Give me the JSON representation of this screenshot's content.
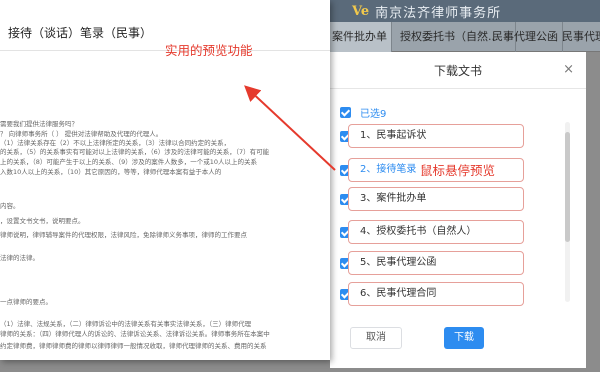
{
  "app": {
    "logo": "Ve",
    "title": "南京法齐律师事务所",
    "tabs": [
      {
        "label": "案件批办单",
        "closable": false
      },
      {
        "label": "授权委托书（自然...",
        "closable": true
      },
      {
        "label": "民事代理公函",
        "closable": false
      },
      {
        "label": "民事代理",
        "closable": false
      }
    ]
  },
  "dialog": {
    "title": "下载文书",
    "close_glyph": "×",
    "select_all_label": "已选9",
    "items": [
      {
        "label": "1、民事起诉状",
        "checked": true
      },
      {
        "label": "2、接待笔录",
        "checked": true
      },
      {
        "label": "3、案件批办单",
        "checked": true
      },
      {
        "label": "4、授权委托书（自然人）",
        "checked": true
      },
      {
        "label": "5、民事代理公函",
        "checked": true
      },
      {
        "label": "6、民事代理合同",
        "checked": true
      }
    ],
    "cancel_label": "取消",
    "download_label": "下载",
    "accent_color": "#2d8cf0",
    "highlight_border_color": "#e6a09a"
  },
  "preview": {
    "title": "接待（谈话）笔录（民事）",
    "lines": [
      "需要我们提供法律服务吗？",
      "？ 向律师事务所（             ）  提供对法律帮助及代理的代理人。",
      "（1）法律关系存在（2）不以上法律所定的关系，（3）法律以合同约定的关系，",
      "的关系，（5）的关系事实有可能对以上法律的关系，（6）涉及的法律可能的关系，（7）有可能",
      "上的关系，（8）可能产生于以上的关系、（9）涉及的案件人数多，一个或10人以上的关系",
      "入数10人以上的关系，（10）其它原因的，等等，律师代理本案有益于本人的",
      "内容。",
      "，设置文书文书，说明要点。",
      "律师说明，律师辅导案件的代理权限，法律风险，免除律师义务事项，律师的工作要点",
      "法律的法律。",
      "一点律师的要点。",
      "（1）法律、法规关系，（二）律师诉讼中的法律关系有关事实法律关系，（三）律师代理",
      "律师的关系：（四）律师代理人的诉讼的、法律诉讼关系、法律诉讼关系。律师事务所在本案中",
      "约定律师费，律师律师费的律师以律师律师一般情况收取，律师代理律师的关系、费用的关系"
    ]
  },
  "annotations": {
    "preview_feature": "实用的预览功能",
    "hover_preview": "鼠标悬停预览",
    "color": "#e53a2d"
  }
}
